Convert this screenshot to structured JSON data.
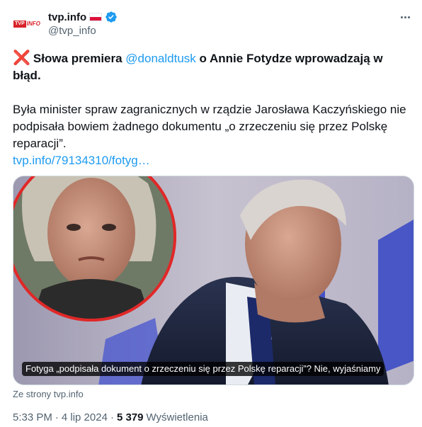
{
  "author": {
    "avatar_box": "TVP",
    "avatar_text": "INFO",
    "display_name": "tvp.info",
    "handle": "@tvp_info"
  },
  "tweet": {
    "mark": "❌",
    "headline_part1": "Słowa premiera ",
    "mention": "@donaldtusk",
    "headline_part2": " o Annie Fotydze wprowadzają w błąd.",
    "body": "Była minister spraw zagranicznych w rządzie Jarosława Kaczyńskiego nie podpisała bowiem żadnego dokumentu „o zrzeczeniu się przez Polskę reparacji”.",
    "link": "tvp.info/79134310/fotyg…"
  },
  "card": {
    "caption": "Fotyga „podpisała dokument o zrzeczeniu się przez Polskę reparacji”? Nie, wyjaśniamy",
    "source": "Ze strony tvp.info"
  },
  "meta": {
    "time": "5:33 PM",
    "date": "4 lip 2024",
    "dot": "·",
    "views_count": "5 379",
    "views_label": "Wyświetlenia"
  },
  "colors": {
    "link": "#1d9bf0",
    "verified": "#1d9bf0",
    "secondary_text": "#536471",
    "flag_red": "#dc143c"
  },
  "icons": [
    "verified-badge-icon",
    "poland-flag-icon",
    "more-options-icon",
    "cross-mark-icon"
  ]
}
